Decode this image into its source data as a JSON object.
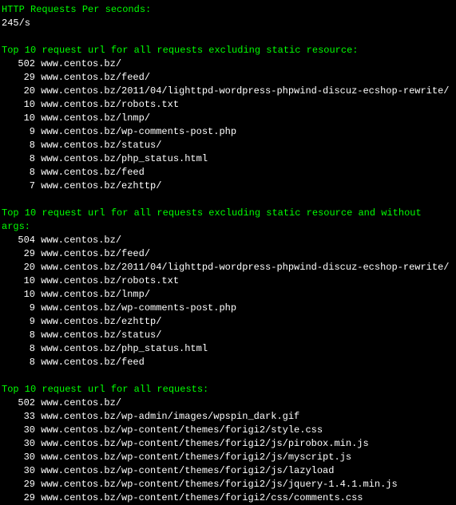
{
  "rps": {
    "label": "HTTP Requests Per seconds:",
    "value": "245/s"
  },
  "sections": [
    {
      "heading": "Top 10 request url for all requests excluding static resource:",
      "rows": [
        {
          "count": "502",
          "url": "www.centos.bz/"
        },
        {
          "count": "29",
          "url": "www.centos.bz/feed/"
        },
        {
          "count": "20",
          "url": "www.centos.bz/2011/04/lighttpd-wordpress-phpwind-discuz-ecshop-rewrite/"
        },
        {
          "count": "10",
          "url": "www.centos.bz/robots.txt"
        },
        {
          "count": "10",
          "url": "www.centos.bz/lnmp/"
        },
        {
          "count": "9",
          "url": "www.centos.bz/wp-comments-post.php"
        },
        {
          "count": "8",
          "url": "www.centos.bz/status/"
        },
        {
          "count": "8",
          "url": "www.centos.bz/php_status.html"
        },
        {
          "count": "8",
          "url": "www.centos.bz/feed"
        },
        {
          "count": "7",
          "url": "www.centos.bz/ezhttp/"
        }
      ]
    },
    {
      "heading": "Top 10 request url for all requests excluding static resource and without args:",
      "rows": [
        {
          "count": "504",
          "url": "www.centos.bz/"
        },
        {
          "count": "29",
          "url": "www.centos.bz/feed/"
        },
        {
          "count": "20",
          "url": "www.centos.bz/2011/04/lighttpd-wordpress-phpwind-discuz-ecshop-rewrite/"
        },
        {
          "count": "10",
          "url": "www.centos.bz/robots.txt"
        },
        {
          "count": "10",
          "url": "www.centos.bz/lnmp/"
        },
        {
          "count": "9",
          "url": "www.centos.bz/wp-comments-post.php"
        },
        {
          "count": "9",
          "url": "www.centos.bz/ezhttp/"
        },
        {
          "count": "8",
          "url": "www.centos.bz/status/"
        },
        {
          "count": "8",
          "url": "www.centos.bz/php_status.html"
        },
        {
          "count": "8",
          "url": "www.centos.bz/feed"
        }
      ]
    },
    {
      "heading": "Top 10 request url for all requests:",
      "rows": [
        {
          "count": "502",
          "url": "www.centos.bz/"
        },
        {
          "count": "33",
          "url": "www.centos.bz/wp-admin/images/wpspin_dark.gif"
        },
        {
          "count": "30",
          "url": "www.centos.bz/wp-content/themes/forigi2/style.css"
        },
        {
          "count": "30",
          "url": "www.centos.bz/wp-content/themes/forigi2/js/pirobox.min.js"
        },
        {
          "count": "30",
          "url": "www.centos.bz/wp-content/themes/forigi2/js/myscript.js"
        },
        {
          "count": "30",
          "url": "www.centos.bz/wp-content/themes/forigi2/js/lazyload"
        },
        {
          "count": "29",
          "url": "www.centos.bz/wp-content/themes/forigi2/js/jquery-1.4.1.min.js"
        },
        {
          "count": "29",
          "url": "www.centos.bz/wp-content/themes/forigi2/css/comments.css"
        }
      ]
    }
  ]
}
